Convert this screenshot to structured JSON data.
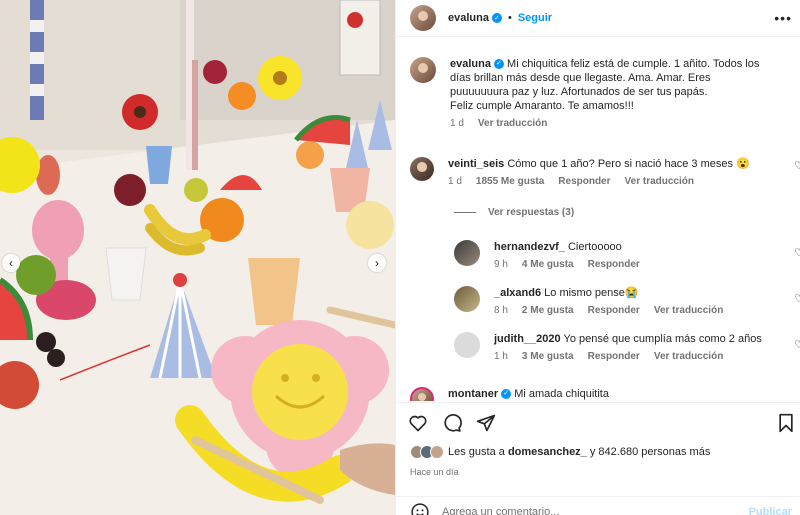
{
  "post": {
    "username": "evaluna",
    "follow_label": "Seguir",
    "separator": "•",
    "more_glyph": "•••"
  },
  "caption": {
    "username": "evaluna",
    "text": "Mi chiquitica feliz está de cumple. 1 añito. Todos los días brillan más desde que llegaste. Ama. Amar. Eres puuuuuuura paz y luz. Afortunados de ser tus papás.",
    "text2": "Feliz cumple Amaranto. Te amamos!!!",
    "time": "1 d",
    "translate": "Ver traducción"
  },
  "comments": [
    {
      "username": "veinti_seis",
      "text": "Cómo que 1 año? Pero si nació hace 3 meses 😮",
      "time": "1 d",
      "likes": "1855 Me gusta",
      "reply": "Responder",
      "translate": "Ver traducción"
    }
  ],
  "view_replies": "Ver respuestas (3)",
  "replies": [
    {
      "username": "hernandezvf_",
      "text": "Ciertooooo",
      "time": "9 h",
      "likes": "4 Me gusta",
      "reply": "Responder",
      "translate": ""
    },
    {
      "username": "_alxand6",
      "text": "Lo mismo pense😭",
      "time": "8 h",
      "likes": "2 Me gusta",
      "reply": "Responder",
      "translate": "Ver traducción"
    },
    {
      "username": "judith__2020",
      "text": "Yo pensé que cumplía más como 2 años",
      "time": "1 h",
      "likes": "3 Me gusta",
      "reply": "Responder",
      "translate": "Ver traducción"
    }
  ],
  "next_comment": {
    "username": "montaner",
    "text": "Mi amada chiquitita"
  },
  "likes": {
    "prefix": "Les gusta a",
    "user": "domesanchez_",
    "suffix": "y 842.680 personas más"
  },
  "posted_ago": "Hace un día",
  "composer": {
    "placeholder": "Agrega un comentario...",
    "publish": "Publicar"
  },
  "icons": {
    "prev": "‹",
    "next": "›",
    "heart": "♡",
    "verified": "✓"
  },
  "colors": {
    "accent": "#0095f6",
    "muted": "#737373",
    "publish_disabled": "#b2dffc"
  }
}
